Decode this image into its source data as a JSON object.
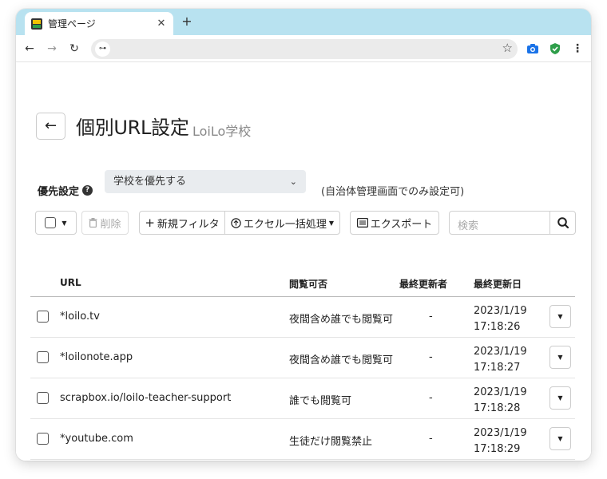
{
  "browser": {
    "tab_title": "管理ページ",
    "tab_close": "✕",
    "new_tab": "+",
    "back": "←",
    "forward": "→",
    "reload": "↻",
    "site_info": "⊶",
    "star": "☆",
    "menu": "⋮"
  },
  "page": {
    "back_arrow": "←",
    "title": "個別URL設定",
    "school_name": "LoiLo学校"
  },
  "priority": {
    "label": "優先設定",
    "help": "?",
    "selected": "学校を優先する",
    "chevron": "⌄",
    "note": "(自治体管理画面でのみ設定可)"
  },
  "actions": {
    "delete_label": "削除",
    "new_filter_label": "新規フィルタ",
    "excel_label": "エクセル一括処理",
    "export_label": "エクスポート",
    "search_placeholder": "検索",
    "caret": "▼"
  },
  "table": {
    "headers": {
      "url": "URL",
      "permission": "閲覧可否",
      "updater": "最終更新者",
      "date": "最終更新日"
    },
    "rows": [
      {
        "url": "*loilo.tv",
        "permission": "夜間含め誰でも閲覧可",
        "updater": "-",
        "date": "2023/1/19",
        "time": "17:18:26"
      },
      {
        "url": "*loilonote.app",
        "permission": "夜間含め誰でも閲覧可",
        "updater": "-",
        "date": "2023/1/19",
        "time": "17:18:27"
      },
      {
        "url": "scrapbox.io/loilo-teacher-support",
        "permission": "誰でも閲覧可",
        "updater": "-",
        "date": "2023/1/19",
        "time": "17:18:28"
      },
      {
        "url": "*youtube.com",
        "permission": "生徒だけ閲覧禁止",
        "updater": "-",
        "date": "2023/1/19",
        "time": "17:18:29"
      }
    ]
  },
  "colors": {
    "tabbar": "#b8e2f0",
    "select_bg": "#e9ecef",
    "shield": "#2e9e4a",
    "camera": "#1a73e8"
  }
}
